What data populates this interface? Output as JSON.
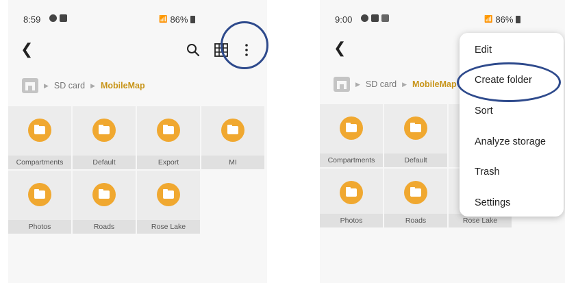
{
  "left": {
    "status": {
      "time": "8:59",
      "battery": "86%",
      "network": "ᐩ"
    },
    "breadcrumb": {
      "root": "SD card",
      "current": "MobileMap"
    },
    "folders": [
      {
        "label": "Compartments"
      },
      {
        "label": "Default"
      },
      {
        "label": "Export"
      },
      {
        "label": "MI"
      },
      {
        "label": "Photos"
      },
      {
        "label": "Roads"
      },
      {
        "label": "Rose Lake"
      }
    ]
  },
  "right": {
    "status": {
      "time": "9:00",
      "battery": "86%",
      "network": "ᐩ"
    },
    "breadcrumb": {
      "root": "SD card",
      "current": "MobileMap"
    },
    "folders": [
      {
        "label": "Compartments"
      },
      {
        "label": "Default"
      },
      {
        "label": "Photos"
      },
      {
        "label": "Roads"
      },
      {
        "label": "Rose Lake"
      }
    ],
    "menu": {
      "items": [
        {
          "label": "Edit"
        },
        {
          "label": "Create folder"
        },
        {
          "label": "Sort"
        },
        {
          "label": "Analyze storage"
        },
        {
          "label": "Trash"
        },
        {
          "label": "Settings"
        }
      ]
    }
  },
  "colors": {
    "accent": "#c8951a",
    "folder": "#f0a830",
    "highlight": "#2e4a8c"
  }
}
